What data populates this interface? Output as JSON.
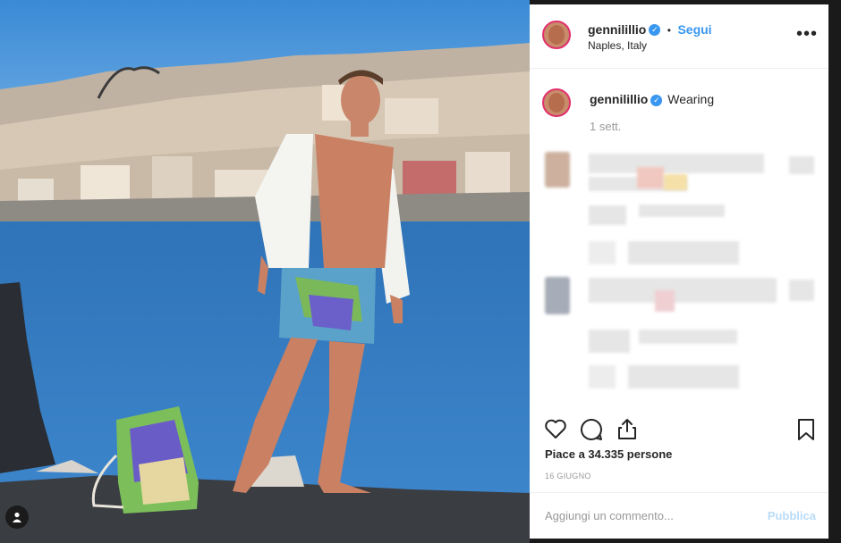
{
  "post": {
    "username": "gennilillio",
    "verified_icon": "verified-badge-icon",
    "separator": "•",
    "follow_label": "Segui",
    "location": "Naples, Italy",
    "more_icon": "more-options-icon",
    "caption_username": "gennilillio",
    "caption_text": "Wearing",
    "caption_time": "1 sett.",
    "likes_text": "Piace a 34.335 persone",
    "date": "16 GIUGNO",
    "comment_placeholder": "Aggiungi un commento...",
    "publish_label": "Pubblica"
  },
  "colors": {
    "accent": "#3897f0",
    "text": "#262626",
    "muted": "#999999",
    "publish_disabled": "#b9dcf9"
  }
}
